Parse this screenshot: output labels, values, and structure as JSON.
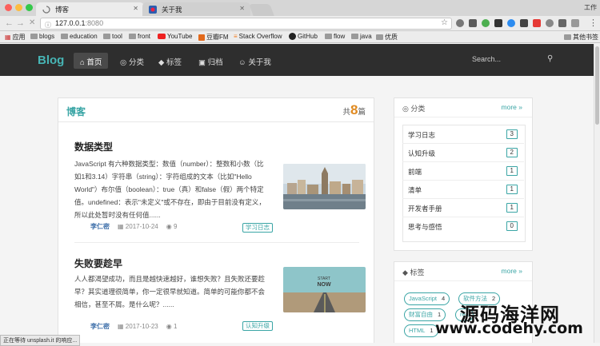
{
  "browser": {
    "tabs": [
      {
        "title": "博客",
        "active": true
      },
      {
        "title": "关于我",
        "active": false
      }
    ],
    "window_label": "工作",
    "url_host": "127.0.0.1",
    "url_port": ":8080",
    "bookmarks": [
      "应用",
      "blogs",
      "education",
      "tool",
      "front",
      "YouTube",
      "豆瓣FM",
      "Stack Overflow",
      "GitHub",
      "flow",
      "java",
      "优质"
    ],
    "other_bookmarks": "其他书签",
    "status_text": "正在等待 unsplash.it 的响应..."
  },
  "site": {
    "logo": "Blog",
    "nav": [
      {
        "label": "首页",
        "icon": "home-icon",
        "active": true
      },
      {
        "label": "分类",
        "icon": "pin-icon",
        "active": false
      },
      {
        "label": "标签",
        "icon": "tag-icon",
        "active": false
      },
      {
        "label": "归档",
        "icon": "archive-icon",
        "active": false
      },
      {
        "label": "关于我",
        "icon": "user-icon",
        "active": false
      }
    ],
    "search_placeholder": "Search..."
  },
  "main": {
    "title": "博客",
    "count_prefix": "共",
    "count": "8",
    "count_suffix": "篇",
    "posts": [
      {
        "title": "数据类型",
        "body": "JavaScript 有六种数据类型：数值（number）：整数和小数（比如1和3.14）字符串（string）：字符组成的文本（比如\"Hello World\"）布尔值（boolean）：true（真）和false（假）两个特定值。undefined：表示\"未定义\"或不存在，即由于目前没有定义，所以此处暂时没有任何值......",
        "author": "李仁密",
        "date": "2017-10-24",
        "views": "9",
        "tag": "学习日志"
      },
      {
        "title": "失败要趁早",
        "body": "人人都渴望成功，而且是越快速越好，谁想失败？且失败还要趁早？其实道理很简单，你一定很早就知道。简单的可能你都不会相信，甚至不屑。是什么呢？......",
        "author": "李仁密",
        "date": "2017-10-23",
        "views": "1",
        "tag": "认知升级",
        "image_text": "START NOW"
      }
    ]
  },
  "sidebar": {
    "categories": {
      "title": "分类",
      "more": "more »",
      "items": [
        {
          "label": "学习日志",
          "count": "3"
        },
        {
          "label": "认知升级",
          "count": "2"
        },
        {
          "label": "前端",
          "count": "1"
        },
        {
          "label": "清单",
          "count": "1"
        },
        {
          "label": "开发者手册",
          "count": "1"
        },
        {
          "label": "思考与感悟",
          "count": "0"
        }
      ]
    },
    "tags": {
      "title": "标签",
      "more": "more »",
      "items": [
        {
          "label": "JavaScript",
          "count": "4"
        },
        {
          "label": "软件方法",
          "count": "2"
        },
        {
          "label": "财富自由",
          "count": "1"
        },
        {
          "label": "rea",
          "count": ""
        },
        {
          "label": "HTML",
          "count": "1"
        }
      ]
    }
  },
  "watermark": {
    "line1": "源码海洋网",
    "line2": "www.codehy.com"
  },
  "colors": {
    "accent": "#3aa5a5",
    "count_orange": "#e08a20",
    "nav_bg": "#2e2e2e"
  }
}
